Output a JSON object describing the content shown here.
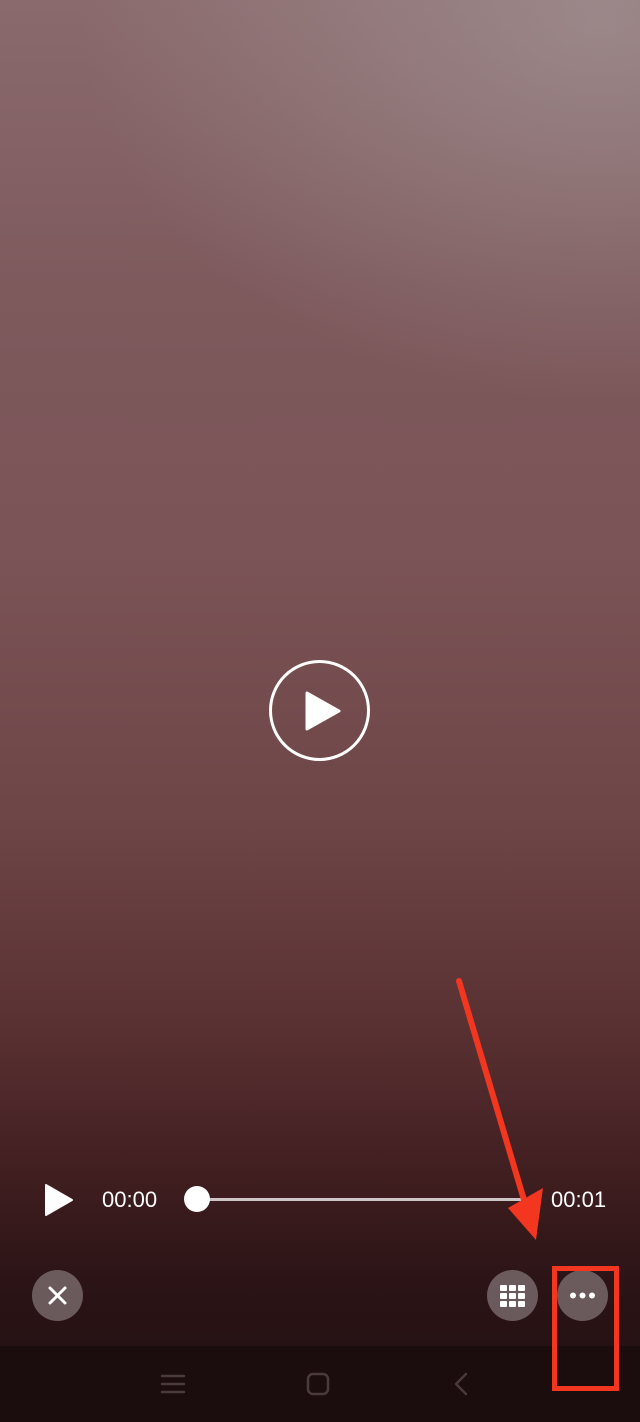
{
  "player": {
    "time_current": "00:00",
    "time_total": "00:01",
    "progress": 0.0
  },
  "icons": {
    "center_play": "play-circle-icon",
    "small_play": "play-icon",
    "close": "close-icon",
    "grid": "grid-icon",
    "more": "more-horizontal-icon",
    "nav_menu": "menu-lines-icon",
    "nav_home": "home-square-icon",
    "nav_back": "back-chevron-icon"
  },
  "colors": {
    "annotation": "#f2361f",
    "text": "#ffffff",
    "round_button": "#a09698"
  }
}
